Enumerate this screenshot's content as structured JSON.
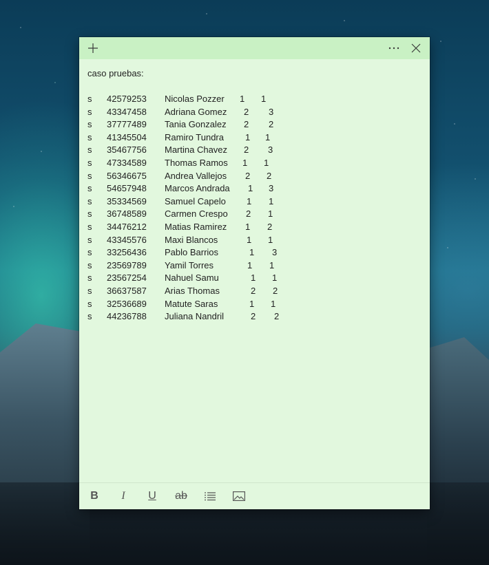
{
  "note": {
    "heading": "caso pruebas:",
    "rows": [
      {
        "s": "s",
        "id": "42579253",
        "name": "Nicolas Pozzer",
        "a": "1",
        "b": "1"
      },
      {
        "s": "s",
        "id": "43347458",
        "name": "Adriana Gomez",
        "a": "2",
        "b": "3"
      },
      {
        "s": "s",
        "id": "37777489",
        "name": "Tania Gonzalez",
        "a": "2",
        "b": "2"
      },
      {
        "s": "s",
        "id": "41345504",
        "name": "Ramiro Tundra",
        "a": "1",
        "b": "1"
      },
      {
        "s": "s",
        "id": "35467756",
        "name": "Martina Chavez",
        "a": "2",
        "b": "3"
      },
      {
        "s": "s",
        "id": "47334589",
        "name": "Thomas Ramos",
        "a": "1",
        "b": "1"
      },
      {
        "s": "s",
        "id": "56346675",
        "name": "Andrea Vallejos",
        "a": "2",
        "b": "2"
      },
      {
        "s": "s",
        "id": "54657948",
        "name": "Marcos Andrada",
        "a": "1",
        "b": "3"
      },
      {
        "s": "s",
        "id": "35334569",
        "name": "Samuel Capelo",
        "a": "1",
        "b": "1"
      },
      {
        "s": "s",
        "id": "36748589",
        "name": "Carmen Crespo",
        "a": "2",
        "b": "1"
      },
      {
        "s": "s",
        "id": "34476212",
        "name": "Matias Ramirez",
        "a": "1",
        "b": "2"
      },
      {
        "s": "s",
        "id": "43345576",
        "name": "Maxi Blancos",
        "a": "1",
        "b": "1"
      },
      {
        "s": "s",
        "id": "33256436",
        "name": "Pablo Barrios",
        "a": "1",
        "b": "3"
      },
      {
        "s": "s",
        "id": "23569789",
        "name": "Yamil Torres",
        "a": "1",
        "b": "1"
      },
      {
        "s": "s",
        "id": "23567254",
        "name": "Nahuel Samu",
        "a": "1",
        "b": "1"
      },
      {
        "s": "s",
        "id": "36637587",
        "name": "Arias Thomas",
        "a": "2",
        "b": "2"
      },
      {
        "s": "s",
        "id": "32536689",
        "name": "Matute Saras",
        "a": "1",
        "b": "1"
      },
      {
        "s": "s",
        "id": "44236788",
        "name": "Juliana Nandril",
        "a": "2",
        "b": "2"
      }
    ]
  },
  "titlebar": {
    "add_icon": "plus-icon",
    "menu_icon": "ellipsis-icon",
    "close_icon": "close-icon"
  },
  "toolbar": {
    "bold": "B",
    "italic": "I",
    "underline": "U",
    "strikethrough": "ab",
    "list_icon": "bulleted-list-icon",
    "image_icon": "image-icon"
  },
  "colors": {
    "note_background": "#e2f8de",
    "titlebar_background": "#c9f1c4"
  }
}
